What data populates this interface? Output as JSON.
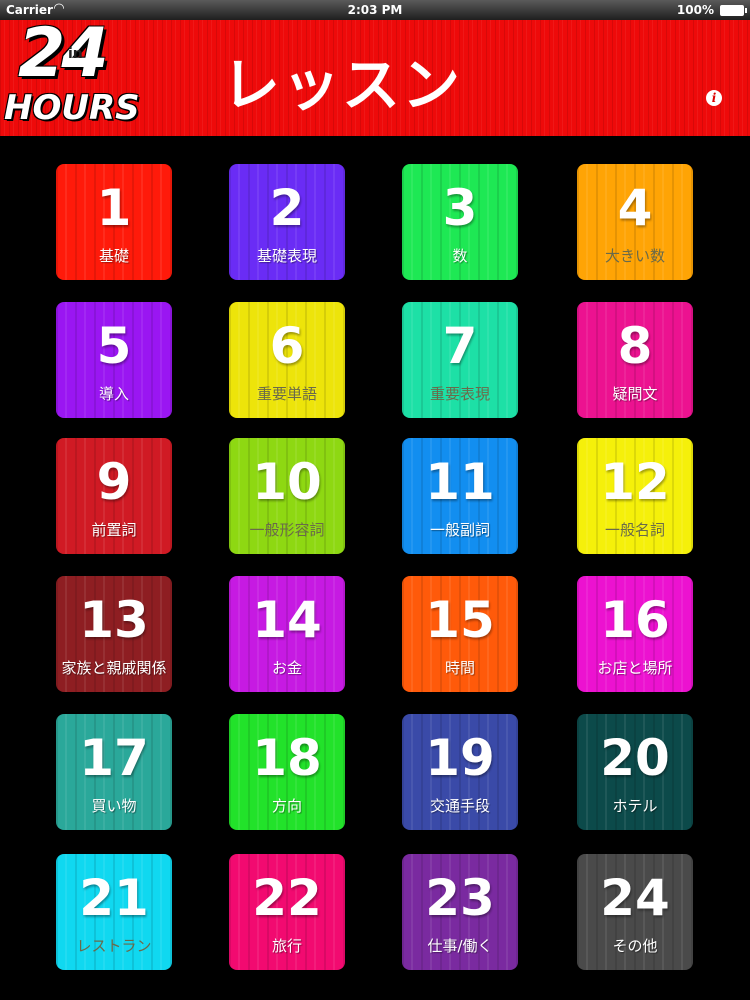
{
  "status_bar": {
    "carrier": "Carrier",
    "time": "2:03 PM",
    "battery": "100%"
  },
  "header": {
    "logo_number": "24",
    "logo_in": "in",
    "logo_hours": "HOURS",
    "title": "レッスン",
    "info_glyph": "i"
  },
  "lessons": [
    {
      "number": "1",
      "label": "基礎",
      "color": "#ff1a0a"
    },
    {
      "number": "2",
      "label": "基礎表現",
      "color": "#6a2cf5"
    },
    {
      "number": "3",
      "label": "数",
      "color": "#1ee854"
    },
    {
      "number": "4",
      "label": "大きい数",
      "color": "#ffa405"
    },
    {
      "number": "5",
      "label": "導入",
      "color": "#9a16f2"
    },
    {
      "number": "6",
      "label": "重要単語",
      "color": "#ede40a"
    },
    {
      "number": "7",
      "label": "重要表現",
      "color": "#1de0a6"
    },
    {
      "number": "8",
      "label": "疑問文",
      "color": "#ec1290"
    },
    {
      "number": "9",
      "label": "前置詞",
      "color": "#d01a24"
    },
    {
      "number": "10",
      "label": "一般形容詞",
      "color": "#8ed812"
    },
    {
      "number": "11",
      "label": "一般副詞",
      "color": "#128ef0"
    },
    {
      "number": "12",
      "label": "一般名詞",
      "color": "#f5f00a"
    },
    {
      "number": "13",
      "label": "家族と親戚関係",
      "color": "#8e1e22"
    },
    {
      "number": "14",
      "label": "お金",
      "color": "#c61ae2"
    },
    {
      "number": "15",
      "label": "時間",
      "color": "#ff5a0a"
    },
    {
      "number": "16",
      "label": "お店と場所",
      "color": "#ec12d0"
    },
    {
      "number": "17",
      "label": "買い物",
      "color": "#2aa89a"
    },
    {
      "number": "18",
      "label": "方向",
      "color": "#22e22a"
    },
    {
      "number": "19",
      "label": "交通手段",
      "color": "#3a4aa8"
    },
    {
      "number": "20",
      "label": "ホテル",
      "color": "#0c4a4a"
    },
    {
      "number": "21",
      "label": "レストラン",
      "color": "#10d8f0"
    },
    {
      "number": "22",
      "label": "旅行",
      "color": "#f20a70"
    },
    {
      "number": "23",
      "label": "仕事/働く",
      "color": "#7a2aa0"
    },
    {
      "number": "24",
      "label": "その他",
      "color": "#4a4a4a"
    }
  ]
}
